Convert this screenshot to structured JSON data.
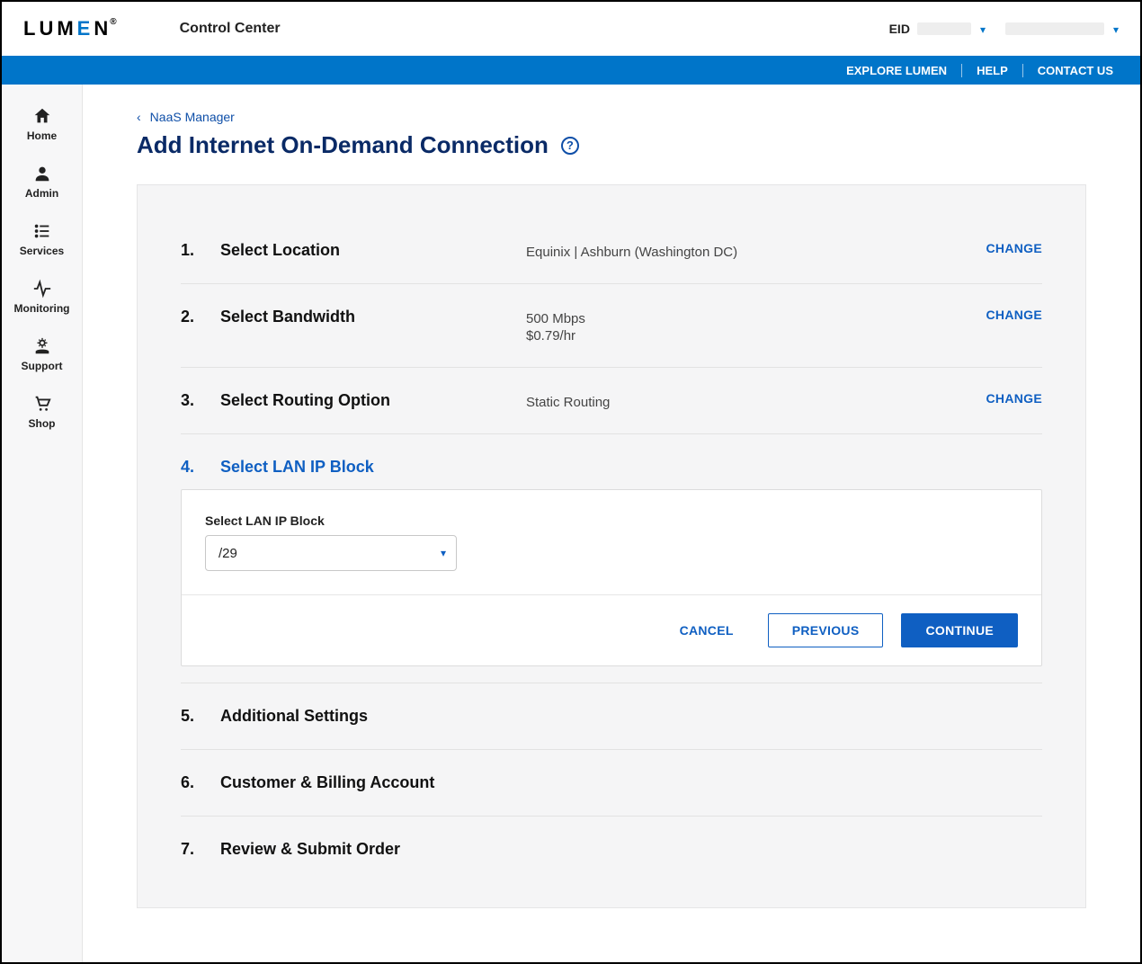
{
  "header": {
    "logo_text_1": "LUM",
    "logo_text_e": "E",
    "logo_text_2": "N",
    "logo_reg": "®",
    "app_title": "Control Center",
    "eid_label": "EID"
  },
  "blue_bar": {
    "explore": "EXPLORE LUMEN",
    "help": "HELP",
    "contact": "CONTACT US"
  },
  "sidebar": {
    "items": [
      {
        "label": "Home"
      },
      {
        "label": "Admin"
      },
      {
        "label": "Services"
      },
      {
        "label": "Monitoring"
      },
      {
        "label": "Support"
      },
      {
        "label": "Shop"
      }
    ]
  },
  "breadcrumb": {
    "label": "NaaS Manager"
  },
  "page_title": "Add Internet On-Demand Connection",
  "steps": {
    "s1": {
      "num": "1.",
      "label": "Select Location",
      "value": "Equinix | Ashburn (Washington DC)",
      "change": "CHANGE"
    },
    "s2": {
      "num": "2.",
      "label": "Select Bandwidth",
      "value": "500 Mbps",
      "value2": "$0.79/hr",
      "change": "CHANGE"
    },
    "s3": {
      "num": "3.",
      "label": "Select Routing Option",
      "value": "Static Routing",
      "change": "CHANGE"
    },
    "s4": {
      "num": "4.",
      "label": "Select LAN IP Block"
    },
    "s5": {
      "num": "5.",
      "label": "Additional Settings"
    },
    "s6": {
      "num": "6.",
      "label": "Customer & Billing Account"
    },
    "s7": {
      "num": "7.",
      "label": "Review & Submit Order"
    }
  },
  "form": {
    "field_label": "Select LAN IP Block",
    "selected_value": "/29"
  },
  "buttons": {
    "cancel": "CANCEL",
    "previous": "PREVIOUS",
    "continue": "CONTINUE"
  }
}
